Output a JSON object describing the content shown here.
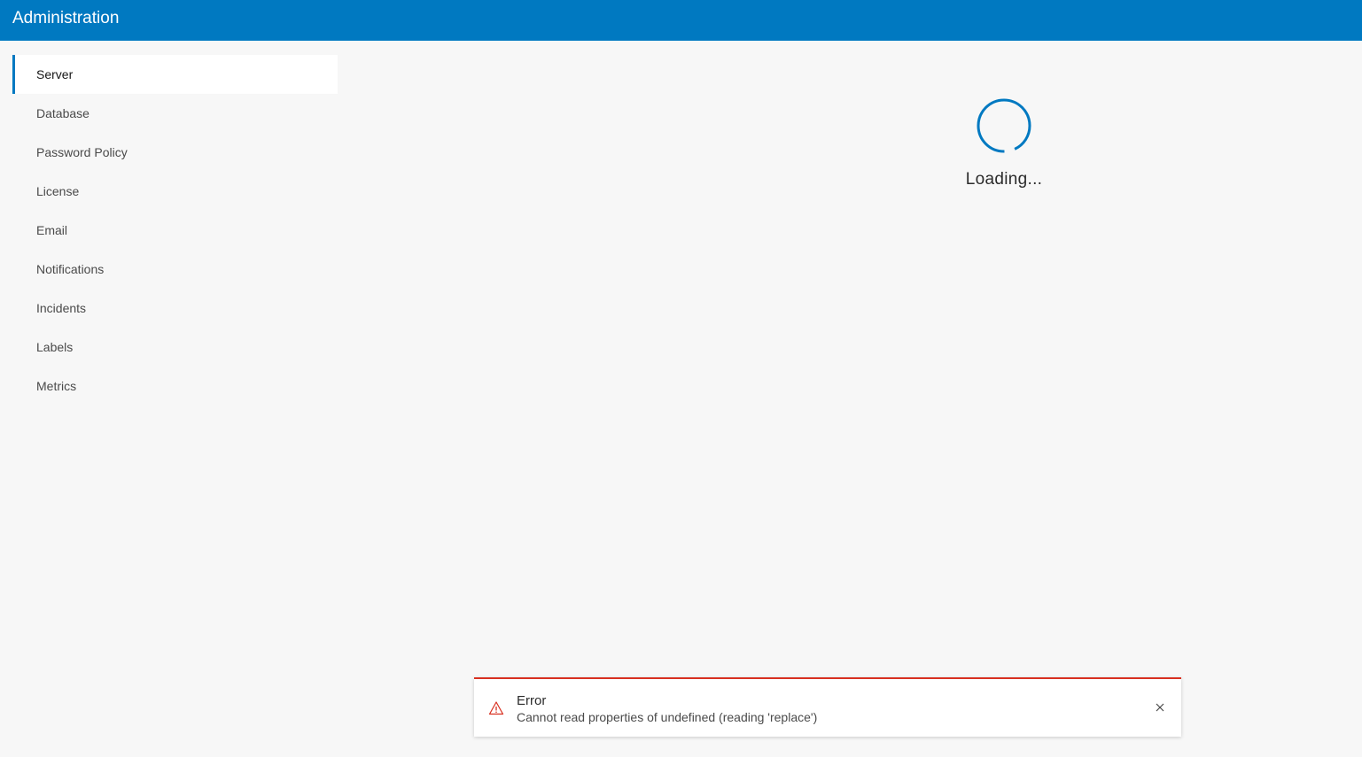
{
  "header": {
    "title": "Administration",
    "background_color": "#0079c1"
  },
  "sidebar": {
    "active_index": 0,
    "items": [
      {
        "label": "Server"
      },
      {
        "label": "Database"
      },
      {
        "label": "Password Policy"
      },
      {
        "label": "License"
      },
      {
        "label": "Email"
      },
      {
        "label": "Notifications"
      },
      {
        "label": "Incidents"
      },
      {
        "label": "Labels"
      },
      {
        "label": "Metrics"
      }
    ]
  },
  "main": {
    "loading": {
      "icon": "loading-spinner-icon",
      "text": "Loading...",
      "color": "#0079c1"
    }
  },
  "toast": {
    "type": "error",
    "icon": "warning-triangle-icon",
    "title": "Error",
    "message": "Cannot read properties of undefined (reading 'replace')",
    "close_icon": "close-icon",
    "accent_color": "#d83020"
  }
}
